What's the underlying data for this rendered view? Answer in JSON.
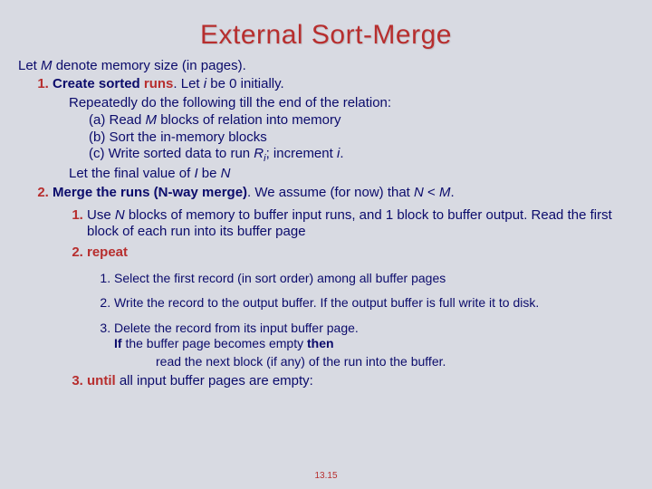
{
  "title": "External Sort-Merge",
  "intro_1": "Let ",
  "intro_M": "M",
  "intro_2": " denote memory size (in pages).",
  "step1": {
    "lead": "Create sorted ",
    "runs": "runs",
    "tail": ".   Let ",
    "i": "i ",
    "tail2": "be 0 initially.",
    "rep": "Repeatedly do the following till the end of the relation:",
    "a_l": "(a)  Read ",
    "a_M": "M",
    "a_r": " blocks of relation into memory",
    "b": "(b)  Sort the in-memory blocks",
    "c_l": "(c)  Write sorted data to run ",
    "c_R": "R",
    "c_sub": "i",
    "c_s": "; increment ",
    "c_i": "i",
    "c_dot": ".",
    "final_l": "Let the final value of ",
    "final_I": "I",
    "final_mid": " be ",
    "final_N": "N"
  },
  "step2": {
    "lead": "Merge the runs (N-way merge)",
    "mid": ". We assume (for now) that ",
    "N": "N",
    "lt": " < ",
    "M": "M",
    "dot": ".",
    "s1_l": "Use ",
    "s1_N": "N ",
    "s1_r": "blocks of memory to buffer input runs, and 1 block to buffer output. Read the first block of each run into its buffer page",
    "repeat": "repeat",
    "r1": "Select the first record (in sort order) among all buffer pages",
    "r2": "Write the record to the output buffer.  If the output buffer is full write it to disk.",
    "r3a": "Delete the record from its input buffer page.",
    "r3_if": "If",
    "r3_mid": " the buffer page becomes empty ",
    "r3_then": "then",
    "r3b": "read the next block (if any) of the run into the buffer.",
    "until": "until",
    "until_r": " all input buffer pages are empty:"
  },
  "pagenum": "13.15"
}
